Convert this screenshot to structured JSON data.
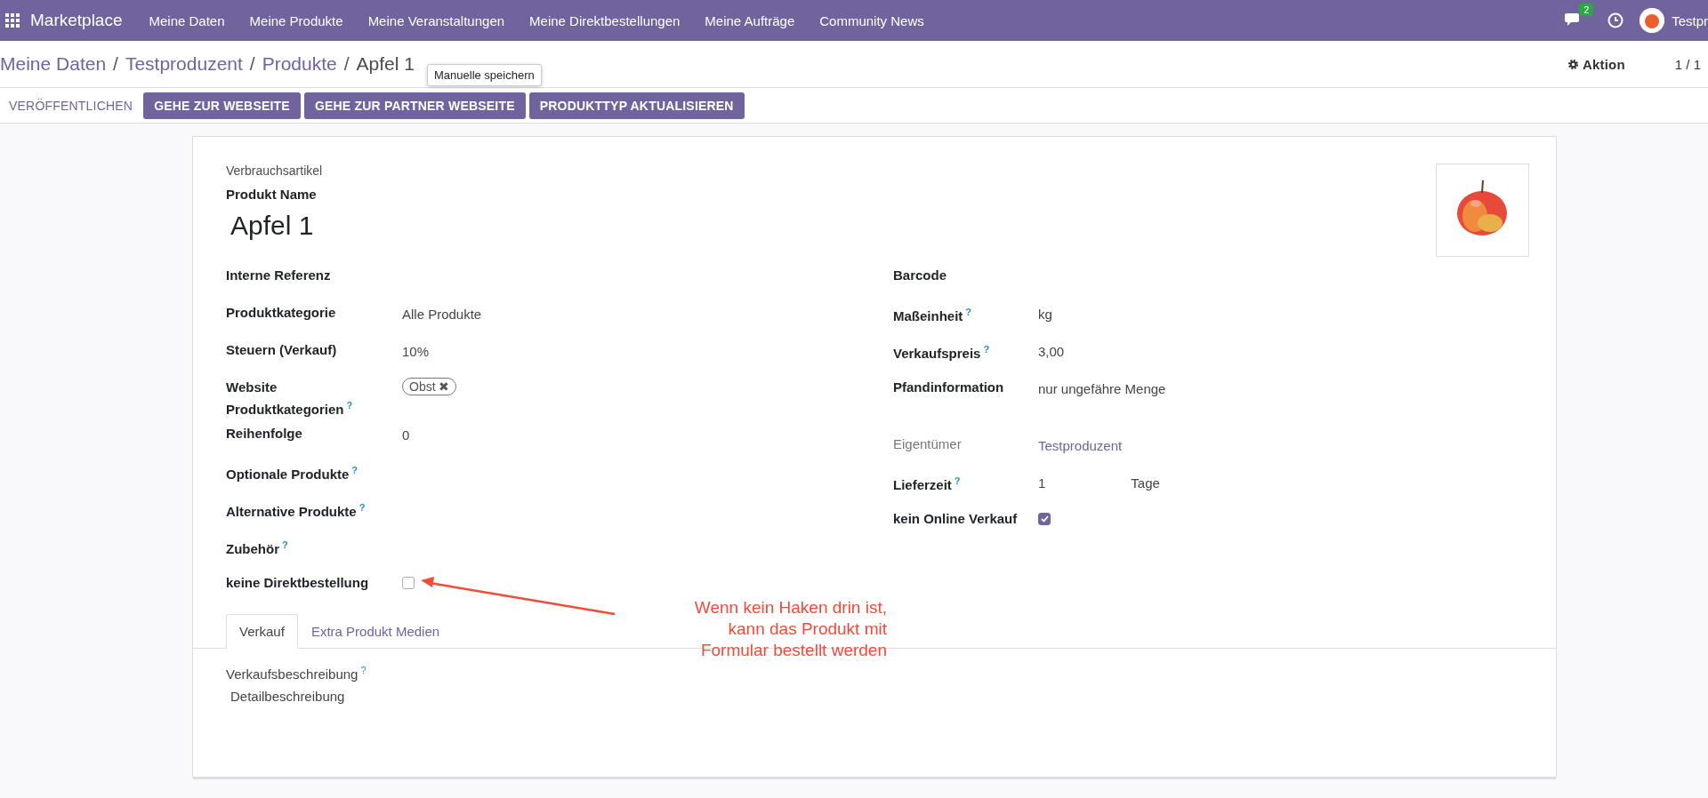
{
  "navbar": {
    "brand": "Marketplace",
    "menu": [
      "Meine Daten",
      "Meine Produkte",
      "Meine Veranstaltungen",
      "Meine Direktbestellungen",
      "Meine Aufträge",
      "Community News"
    ],
    "messages_badge": "2",
    "user": "Testpr"
  },
  "breadcrumb": {
    "items": [
      "Meine Daten",
      "Testproduzent",
      "Produkte"
    ],
    "separator": "/",
    "current": "Apfel 1"
  },
  "action": "Aktion",
  "pager": "1 / 1",
  "tooltip": "Manuelle speichern",
  "buttons": [
    {
      "label": "VERÖFFENTLICHEN",
      "kind": "link"
    },
    {
      "label": "GEHE ZUR WEBSEITE",
      "kind": "primary"
    },
    {
      "label": "GEHE ZUR PARTNER WEBSEITE",
      "kind": "primary"
    },
    {
      "label": "PRODUKTTYP AKTUALISIEREN",
      "kind": "primary"
    }
  ],
  "form": {
    "type_label": "Verbrauchsartikel",
    "name_label": "Produkt Name",
    "name": "Apfel 1",
    "left_fields": [
      {
        "label": "Interne Referenz",
        "kind": "text"
      },
      {
        "label": "Produktkategorie",
        "kind": "text",
        "value": "Alle Produkte"
      },
      {
        "label": "Steuern (Verkauf)",
        "kind": "text",
        "value": "10%"
      },
      {
        "label": "Website Produktkategorien",
        "help": "?",
        "kind": "tag",
        "value": "Obst",
        "remove": "✖"
      },
      {
        "label": "Reihenfolge",
        "kind": "text",
        "value": "0"
      },
      {
        "label": "Optionale Produkte",
        "help": "?",
        "kind": "text"
      },
      {
        "label": "Alternative Produkte",
        "help": "?",
        "kind": "text"
      },
      {
        "label": "Zubehör",
        "help": "?",
        "kind": "text"
      },
      {
        "label": "keine Direktbestellung",
        "kind": "checkbox",
        "checked": false
      }
    ],
    "right_fields": [
      {
        "label": "Barcode",
        "kind": "text"
      },
      {
        "label": "Maßeinheit",
        "help": "?",
        "kind": "text",
        "value": "kg"
      },
      {
        "label": "Verkaufspreis",
        "help": "?",
        "kind": "text",
        "value": "3,00"
      },
      {
        "label": "Pfandinformation",
        "kind": "text",
        "value": "nur ungefähre Menge"
      },
      {
        "label": "Eigentümer",
        "kind": "link",
        "value": "Testproduzent"
      },
      {
        "label": "Lieferzeit",
        "help": "?",
        "kind": "unit",
        "value": "1",
        "unit": "Tage"
      },
      {
        "label": "kein Online Verkauf",
        "kind": "checkbox",
        "checked": true
      }
    ]
  },
  "tabs": [
    {
      "label": "Verkauf",
      "selected": true
    },
    {
      "label": "Extra Produkt Medien",
      "selected": false
    }
  ],
  "description": {
    "label": "Verkaufsbeschreibung",
    "help": "?",
    "value": "Detailbeschreibung"
  },
  "annotation": {
    "lines": [
      "Wenn kein Haken drin ist,",
      "kann das Produkt mit",
      "Formular bestellt werden"
    ]
  }
}
